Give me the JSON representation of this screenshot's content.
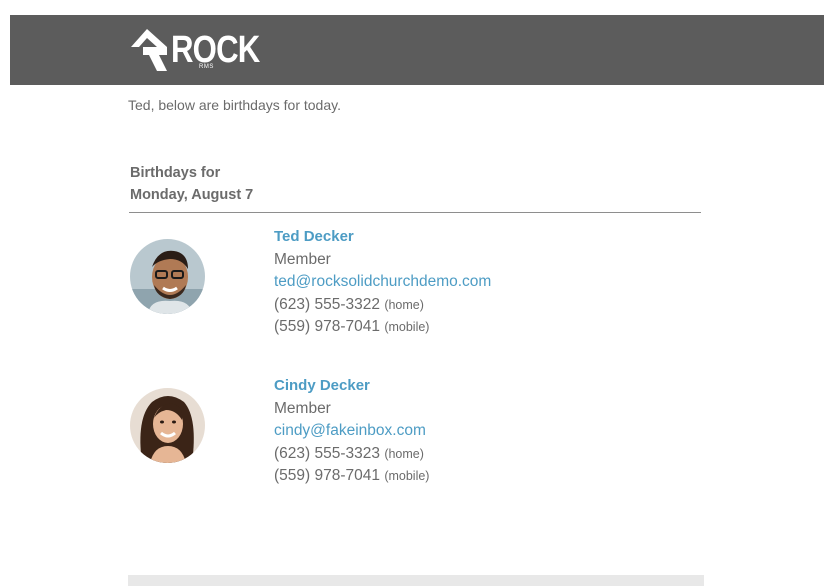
{
  "header": {
    "logo_text": "ROCK",
    "logo_sub": "RMS",
    "bg_color": "#5c5c5c"
  },
  "intro_text": "Ted, below are birthdays for today.",
  "section": {
    "title_line1": "Birthdays for",
    "title_line2": "Monday, August 7"
  },
  "people": [
    {
      "name": "Ted Decker",
      "role": "Member",
      "email": "ted@rocksolidchurchdemo.com",
      "phones": [
        {
          "number": "(623) 555-3322",
          "type": "(home)"
        },
        {
          "number": "(559) 978-7041",
          "type": "(mobile)"
        }
      ]
    },
    {
      "name": "Cindy Decker",
      "role": "Member",
      "email": "cindy@fakeinbox.com",
      "phones": [
        {
          "number": "(623) 555-3323",
          "type": "(home)"
        },
        {
          "number": "(559) 978-7041",
          "type": "(mobile)"
        }
      ]
    }
  ],
  "colors": {
    "link": "#4d9cc4",
    "text": "#6b6b6b"
  }
}
